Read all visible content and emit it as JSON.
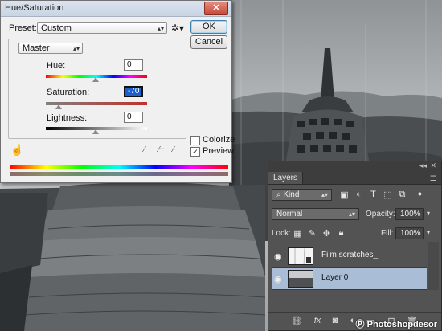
{
  "dialog": {
    "title": "Hue/Saturation",
    "close_glyph": "✕",
    "preset_label": "Preset:",
    "preset_value": "Custom",
    "ok_label": "OK",
    "cancel_label": "Cancel",
    "channel": "Master",
    "hue_label": "Hue:",
    "hue_value": "0",
    "saturation_label": "Saturation:",
    "saturation_value": "-70",
    "lightness_label": "Lightness:",
    "lightness_value": "0",
    "colorize_label": "Colorize",
    "colorize_checked": false,
    "preview_label": "Preview",
    "preview_checked": true
  },
  "layers_panel": {
    "tab_label": "Layers",
    "filter_kind": "Kind",
    "blend_mode": "Normal",
    "opacity_label": "Opacity:",
    "opacity_value": "100%",
    "lock_label": "Lock:",
    "fill_label": "Fill:",
    "fill_value": "100%",
    "layers": [
      {
        "name": "Film scratches_",
        "visible": true,
        "selected": false
      },
      {
        "name": "Layer 0",
        "visible": true,
        "selected": true
      }
    ]
  },
  "watermark": "Photoshopdesor",
  "icons": {
    "hand": "hand-adjust-icon",
    "eyedroppers": [
      "eyedropper-icon",
      "eyedropper-plus-icon",
      "eyedropper-minus-icon"
    ],
    "gear": "gear-icon"
  },
  "colors": {
    "selected_layer": "#a9bed6",
    "dialog_bg": "#f0f0f0",
    "panel_bg": "#535353"
  }
}
